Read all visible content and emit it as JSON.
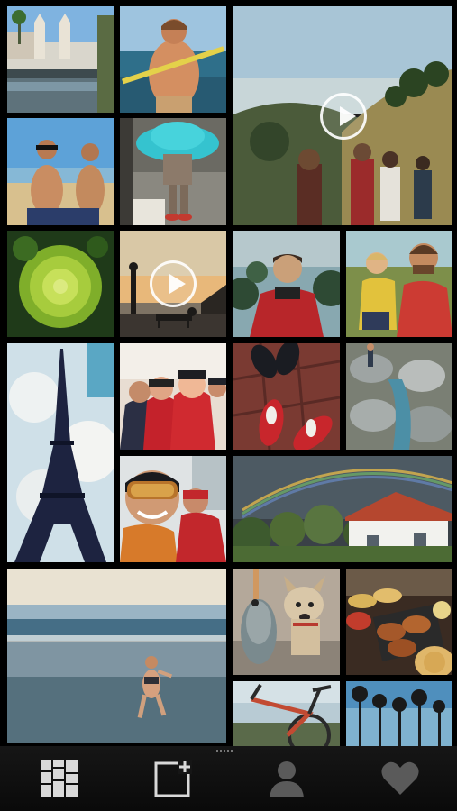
{
  "feed": {
    "tiles": [
      {
        "name": "photo-mission-fountain",
        "video": false
      },
      {
        "name": "photo-kayaker",
        "video": false
      },
      {
        "name": "video-hiking-hills",
        "video": true
      },
      {
        "name": "photo-beach-friends",
        "video": false
      },
      {
        "name": "photo-blue-hat",
        "video": false
      },
      {
        "name": "photo-romanesco",
        "video": false
      },
      {
        "name": "video-sunset-dog",
        "video": true
      },
      {
        "name": "photo-man-red-jacket",
        "video": false
      },
      {
        "name": "photo-father-child",
        "video": false
      },
      {
        "name": "photo-eiffel-tower",
        "video": false
      },
      {
        "name": "photo-ski-selfie",
        "video": false
      },
      {
        "name": "photo-sneakers",
        "video": false
      },
      {
        "name": "photo-rocky-stream",
        "video": false
      },
      {
        "name": "photo-ski-goggles",
        "video": false
      },
      {
        "name": "photo-rainbow-house",
        "video": false
      },
      {
        "name": "photo-child-beach",
        "video": false
      },
      {
        "name": "photo-dog-fish",
        "video": false
      },
      {
        "name": "photo-baked-food",
        "video": false
      },
      {
        "name": "photo-bicycle",
        "video": false
      },
      {
        "name": "photo-palm-trees",
        "video": false
      }
    ]
  },
  "tabbar": {
    "tabs": [
      {
        "name": "tab-grid",
        "icon": "grid-icon"
      },
      {
        "name": "tab-new-post",
        "icon": "new-post-icon"
      },
      {
        "name": "tab-profile",
        "icon": "person-icon"
      },
      {
        "name": "tab-favorites",
        "icon": "heart-icon"
      }
    ]
  }
}
